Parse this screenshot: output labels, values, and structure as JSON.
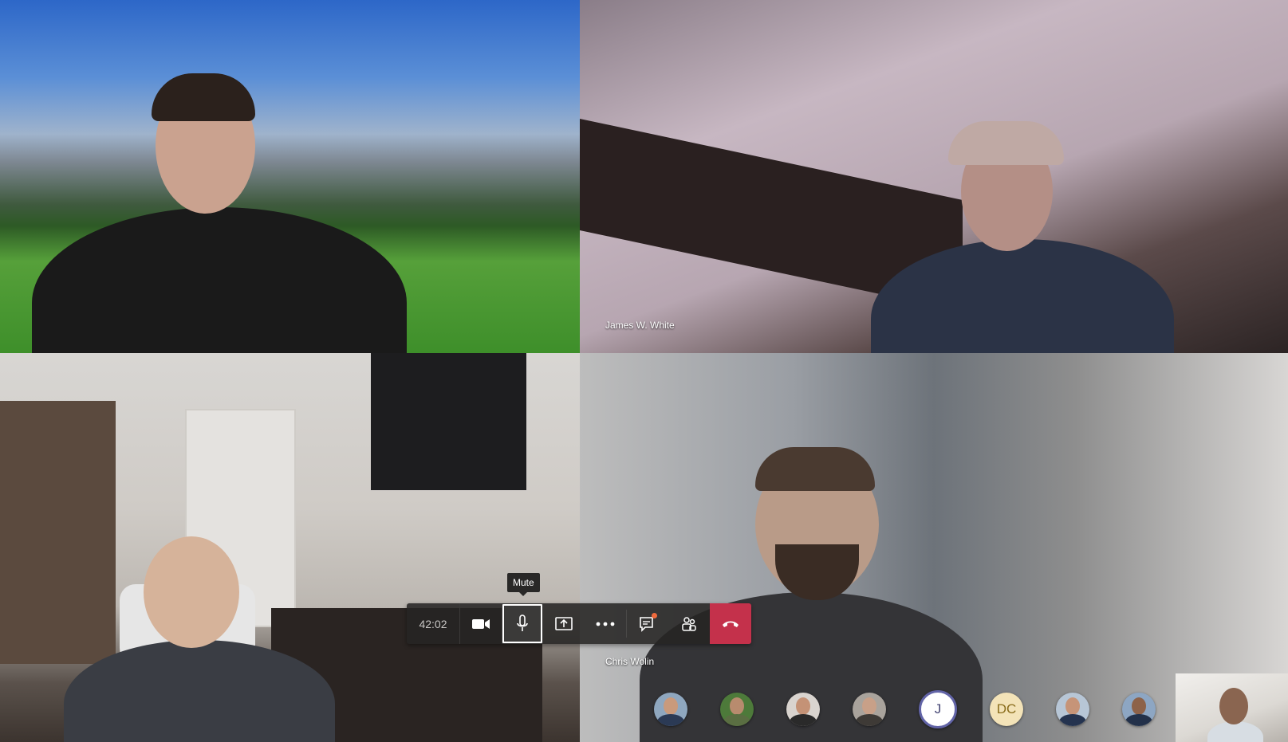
{
  "meeting": {
    "timer": "42:02"
  },
  "participants": {
    "tile_1": {
      "name": ""
    },
    "tile_2": {
      "name": "James W. White"
    },
    "tile_3": {
      "name": ""
    },
    "tile_4": {
      "name": "Chris Wolin"
    }
  },
  "toolbar": {
    "tooltip": "Mute",
    "buttons": [
      {
        "id": "camera",
        "icon": "video-camera-icon"
      },
      {
        "id": "mic",
        "icon": "microphone-icon",
        "active": true
      },
      {
        "id": "share",
        "icon": "share-screen-icon"
      },
      {
        "id": "more",
        "icon": "more-actions-icon"
      },
      {
        "id": "chat",
        "icon": "chat-icon",
        "notification": true
      },
      {
        "id": "participants",
        "icon": "people-icon"
      },
      {
        "id": "hangup",
        "icon": "hang-up-icon"
      }
    ]
  },
  "roster": [
    {
      "type": "photo"
    },
    {
      "type": "photo"
    },
    {
      "type": "photo"
    },
    {
      "type": "photo"
    },
    {
      "type": "initials",
      "initials": "J"
    },
    {
      "type": "initials",
      "initials": "DC"
    },
    {
      "type": "photo"
    },
    {
      "type": "photo"
    }
  ],
  "colors": {
    "hangup": "#c4314b",
    "toolbar_bg": "#252423",
    "accent": "#6264a7",
    "notification_dot": "#f06a3c"
  }
}
